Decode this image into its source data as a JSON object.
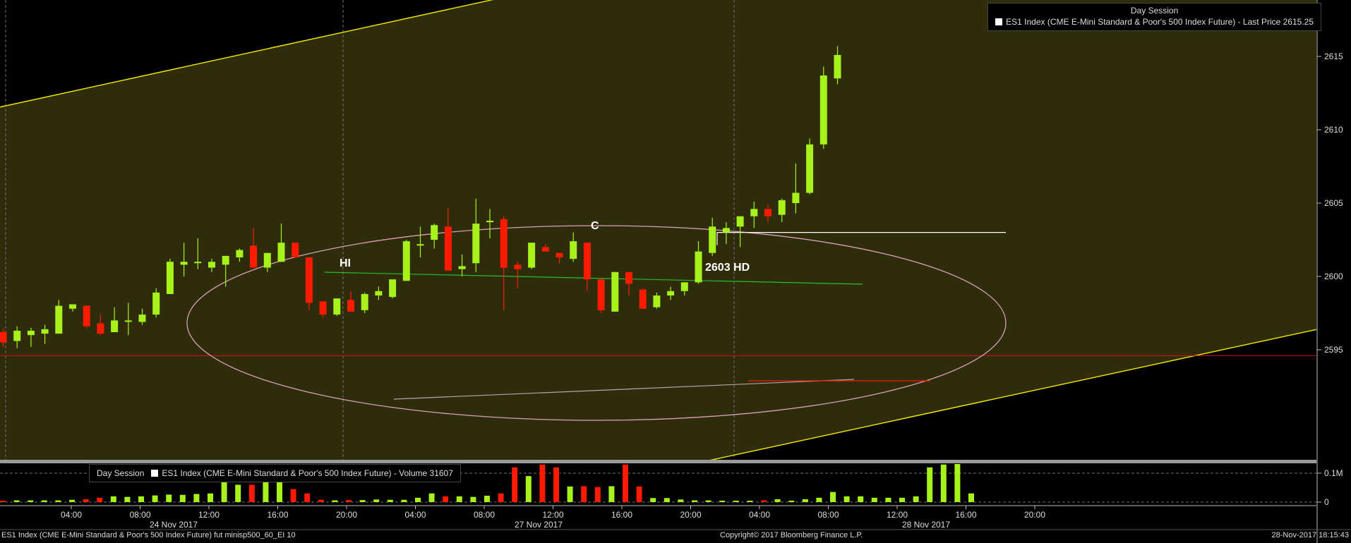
{
  "legend_top": {
    "title": "Day Session",
    "label": "ES1 Index (CME E-Mini Standard & Poor's 500 Index Future) - Last Price 2615.25"
  },
  "legend_volume": {
    "title": "Day Session",
    "label": "ES1 Index (CME E-Mini Standard & Poor's 500 Index Future) - Volume 31607"
  },
  "footer": {
    "left": "ES1 Index (CME E-Mini Standard & Poor's 500 Index Future) fut minisp500_60_EI 10",
    "center": "Copyright© 2017 Bloomberg Finance L.P.",
    "right": "28-Nov-2017 18:15:43"
  },
  "colors": {
    "up": "#a6f21a",
    "down": "#ff1a00",
    "channel": "#e8e000",
    "ellipse": "#d9a0b8",
    "neckline": "#22c02a",
    "support": "#aaaaaa",
    "hd_line": "#ffffff",
    "red_level": "#e01010"
  },
  "chart_data": [
    {
      "type": "candlestick",
      "interval": "60 min",
      "y_ticks": [
        2595,
        2600,
        2605,
        2610,
        2615
      ],
      "ylim": [
        2593,
        2617.5
      ],
      "x_tick_labels": [
        "04:00",
        "08:00",
        "12:00",
        "16:00",
        "20:00",
        "04:00",
        "08:00",
        "12:00",
        "16:00",
        "20:00",
        "04:00",
        "08:00",
        "12:00",
        "16:00",
        "20:00"
      ],
      "date_labels": [
        "24 Nov 2017",
        "27 Nov 2017",
        "28 Nov 2017"
      ],
      "annotations": [
        "HI",
        "C",
        "2603 HD"
      ],
      "levels": {
        "red_line": 2594.6,
        "hd_line": 2603
      },
      "candles": [
        [
          2596.2,
          2596.4,
          2595.2,
          2595.5
        ],
        [
          2595.6,
          2596.6,
          2595.1,
          2596.3
        ],
        [
          2596.0,
          2596.5,
          2595.2,
          2596.3
        ],
        [
          2596.1,
          2596.7,
          2595.4,
          2596.4
        ],
        [
          2596.1,
          2598.4,
          2596.1,
          2598.0
        ],
        [
          2597.8,
          2598.1,
          2597.6,
          2598.1
        ],
        [
          2598.0,
          2598.0,
          2596.5,
          2596.6
        ],
        [
          2596.8,
          2597.4,
          2596.0,
          2596.1
        ],
        [
          2596.2,
          2597.9,
          2596.2,
          2597.0
        ],
        [
          2597.0,
          2598.2,
          2596.0,
          2597.0
        ],
        [
          2596.9,
          2597.8,
          2596.7,
          2597.4
        ],
        [
          2597.4,
          2599.2,
          2597.2,
          2598.9
        ],
        [
          2598.8,
          2601.2,
          2598.8,
          2601.0
        ],
        [
          2600.8,
          2602.3,
          2600.0,
          2601.0
        ],
        [
          2601.0,
          2602.6,
          2600.5,
          2601.0
        ],
        [
          2600.6,
          2601.2,
          2600.3,
          2601.0
        ],
        [
          2600.8,
          2601.4,
          2599.3,
          2601.4
        ],
        [
          2601.3,
          2601.9,
          2601.0,
          2601.8
        ],
        [
          2602.1,
          2603.3,
          2600.7,
          2600.6
        ],
        [
          2600.6,
          2601.6,
          2600.3,
          2601.6
        ],
        [
          2601.0,
          2603.6,
          2601.0,
          2602.3
        ],
        [
          2602.3,
          2602.3,
          2601.3,
          2601.3
        ],
        [
          2601.3,
          2601.3,
          2597.7,
          2598.2
        ],
        [
          2598.3,
          2598.3,
          2597.2,
          2597.4
        ],
        [
          2597.4,
          2598.5,
          2597.3,
          2598.5
        ],
        [
          2598.4,
          2599.0,
          2597.6,
          2597.6
        ],
        [
          2597.7,
          2598.9,
          2597.5,
          2598.8
        ],
        [
          2598.7,
          2599.3,
          2598.4,
          2599.0
        ],
        [
          2598.6,
          2599.8,
          2598.5,
          2599.8
        ],
        [
          2599.7,
          2602.5,
          2599.7,
          2602.4
        ],
        [
          2602.2,
          2603.4,
          2601.3,
          2602.2
        ],
        [
          2602.5,
          2603.6,
          2601.9,
          2603.5
        ],
        [
          2603.4,
          2604.7,
          2603.0,
          2600.4
        ],
        [
          2600.5,
          2601.5,
          2600.0,
          2600.7
        ],
        [
          2600.9,
          2605.3,
          2600.3,
          2603.6
        ],
        [
          2603.7,
          2604.6,
          2602.6,
          2603.8
        ],
        [
          2603.9,
          2604.1,
          2597.7,
          2600.6
        ],
        [
          2600.8,
          2601.0,
          2599.2,
          2600.5
        ],
        [
          2600.6,
          2602.3,
          2600.5,
          2602.3
        ],
        [
          2602.0,
          2602.2,
          2601.7,
          2601.7
        ],
        [
          2601.6,
          2601.6,
          2600.9,
          2601.3
        ],
        [
          2601.2,
          2603.0,
          2601.0,
          2602.4
        ],
        [
          2602.3,
          2602.3,
          2599.0,
          2599.8
        ],
        [
          2599.8,
          2599.8,
          2597.5,
          2597.7
        ],
        [
          2597.6,
          2600.3,
          2597.6,
          2600.3
        ],
        [
          2600.3,
          2600.3,
          2598.7,
          2599.5
        ],
        [
          2599.1,
          2599.2,
          2597.8,
          2597.8
        ],
        [
          2597.9,
          2598.9,
          2597.8,
          2598.7
        ],
        [
          2598.7,
          2599.3,
          2598.4,
          2599.0
        ],
        [
          2599.0,
          2599.6,
          2598.7,
          2599.6
        ],
        [
          2599.6,
          2602.4,
          2599.5,
          2601.7
        ],
        [
          2601.6,
          2604.0,
          2601.4,
          2603.4
        ],
        [
          2603.0,
          2603.7,
          2602.2,
          2603.3
        ],
        [
          2603.4,
          2603.8,
          2602.0,
          2604.1
        ],
        [
          2604.1,
          2605.1,
          2603.3,
          2604.6
        ],
        [
          2604.6,
          2604.9,
          2603.7,
          2604.1
        ],
        [
          2604.2,
          2605.3,
          2603.7,
          2605.2
        ],
        [
          2605.0,
          2607.7,
          2604.3,
          2605.7
        ],
        [
          2605.7,
          2609.4,
          2605.6,
          2609.0
        ],
        [
          2609.0,
          2614.3,
          2608.7,
          2613.7
        ],
        [
          2613.5,
          2615.7,
          2613.1,
          2615.1
        ]
      ]
    },
    {
      "type": "bar",
      "y_ticks_labels": [
        "0.1M",
        "0"
      ],
      "ylim": [
        0,
        0.16
      ],
      "values": [
        0.005,
        0.006,
        0.006,
        0.006,
        0.006,
        0.008,
        0.01,
        0.015,
        0.02,
        0.018,
        0.02,
        0.023,
        0.026,
        0.025,
        0.028,
        0.03,
        0.07,
        0.06,
        0.06,
        0.07,
        0.08,
        0.045,
        0.03,
        0.008,
        0.006,
        0.007,
        0.007,
        0.009,
        0.008,
        0.008,
        0.015,
        0.03,
        0.02,
        0.02,
        0.018,
        0.022,
        0.03,
        0.12,
        0.09,
        0.13,
        0.12,
        0.054,
        0.055,
        0.052,
        0.055,
        0.13,
        0.054,
        0.014,
        0.014,
        0.009,
        0.006,
        0.006,
        0.005,
        0.004,
        0.004,
        0.006,
        0.01,
        0.005,
        0.01,
        0.015,
        0.035,
        0.02,
        0.02,
        0.015,
        0.015,
        0.015,
        0.02,
        0.12,
        0.13,
        0.135,
        0.03
      ]
    }
  ]
}
